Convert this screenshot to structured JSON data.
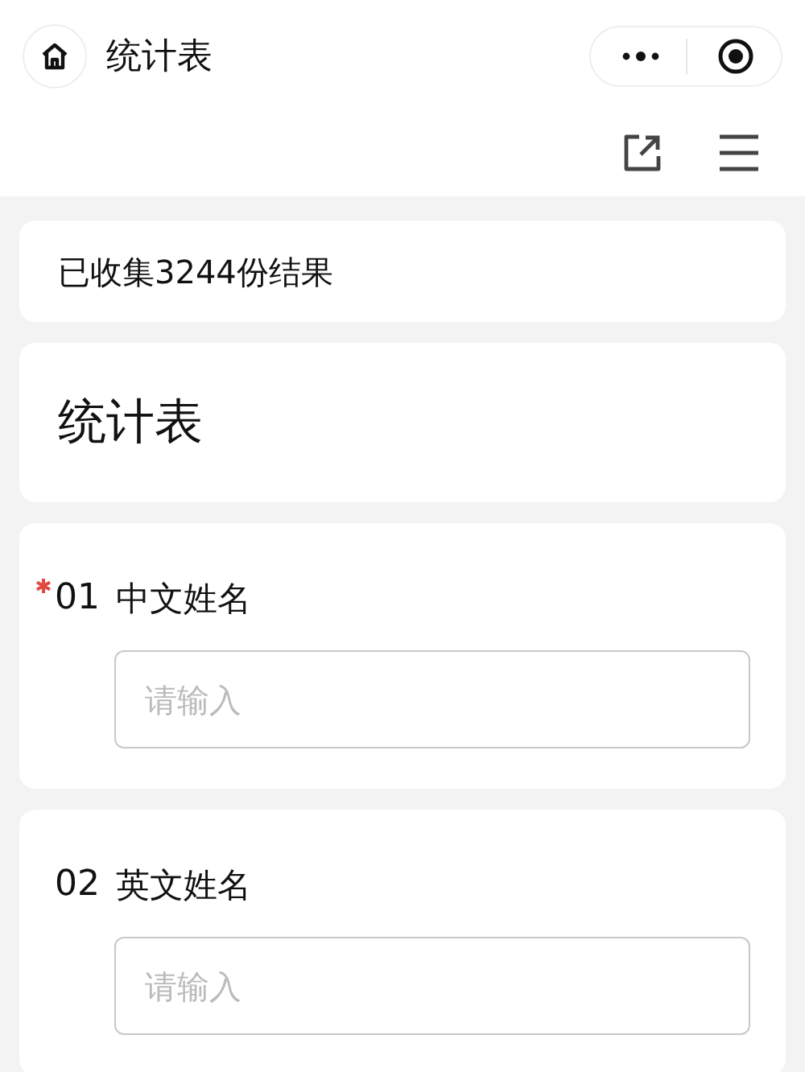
{
  "nav_bar": {
    "title": "统计表"
  },
  "summary": "已收集3244份结果",
  "form_title": "统计表",
  "questions": [
    {
      "number": "01",
      "label": "中文姓名",
      "required": true,
      "placeholder": "请输入"
    },
    {
      "number": "02",
      "label": "英文姓名",
      "required": false,
      "placeholder": "请输入"
    }
  ]
}
